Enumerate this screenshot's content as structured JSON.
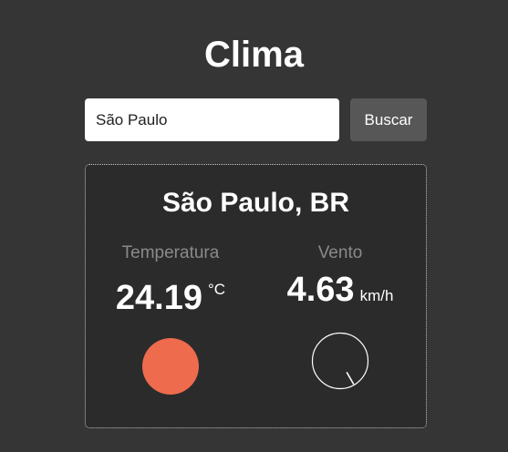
{
  "app": {
    "title": "Clima"
  },
  "search": {
    "value": "São Paulo",
    "button_label": "Buscar"
  },
  "weather": {
    "city": "São Paulo, BR",
    "temperature": {
      "label": "Temperatura",
      "value": "24.19",
      "unit": "°C",
      "indicator_color": "#ee6b4d"
    },
    "wind": {
      "label": "Vento",
      "value": "4.63",
      "unit": "km/h",
      "needle_angle_deg": 150
    }
  },
  "colors": {
    "background": "#353535",
    "card": "#2b2b2b",
    "button": "#575757"
  }
}
